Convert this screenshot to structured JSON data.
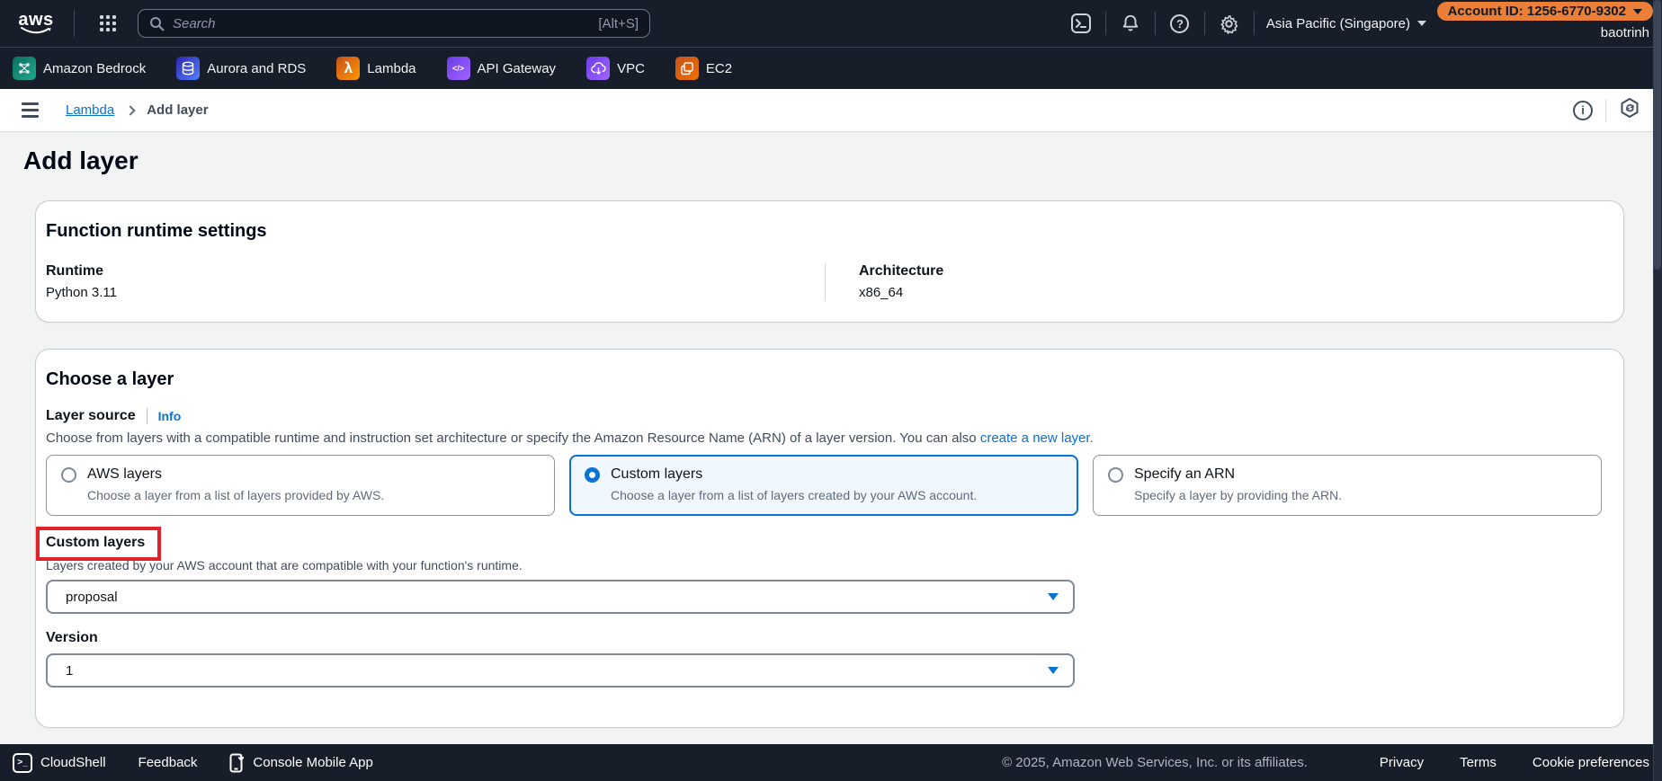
{
  "topbar": {
    "logo": "aws",
    "search_placeholder": "Search",
    "search_shortcut": "[Alt+S]",
    "region_label": "Asia Pacific (Singapore)",
    "account_badge": "Account ID: 1256-6770-9302",
    "username": "baotrinh"
  },
  "favorites": {
    "items": [
      {
        "label": "Amazon Bedrock"
      },
      {
        "label": "Aurora and RDS"
      },
      {
        "label": "Lambda"
      },
      {
        "label": "API Gateway"
      },
      {
        "label": "VPC"
      },
      {
        "label": "EC2"
      }
    ]
  },
  "breadcrumb": {
    "root": "Lambda",
    "current": "Add layer"
  },
  "page_title": "Add layer",
  "runtime_card": {
    "title": "Function runtime settings",
    "runtime_label": "Runtime",
    "runtime_value": "Python 3.11",
    "architecture_label": "Architecture",
    "architecture_value": "x86_64"
  },
  "layer_card": {
    "title": "Choose a layer",
    "source_label": "Layer source",
    "info_link": "Info",
    "description": "Choose from layers with a compatible runtime and instruction set architecture or specify the Amazon Resource Name (ARN) of a layer version. You can also ",
    "description_link": "create a new layer.",
    "options": [
      {
        "title": "AWS layers",
        "desc": "Choose a layer from a list of layers provided by AWS.",
        "selected": false
      },
      {
        "title": "Custom layers",
        "desc": "Choose a layer from a list of layers created by your AWS account.",
        "selected": true
      },
      {
        "title": "Specify an ARN",
        "desc": "Specify a layer by providing the ARN.",
        "selected": false
      }
    ],
    "custom": {
      "label": "Custom layers",
      "desc": "Layers created by your AWS account that are compatible with your function's runtime.",
      "select_value": "proposal"
    },
    "version": {
      "label": "Version",
      "select_value": "1"
    }
  },
  "footer": {
    "cloudshell": "CloudShell",
    "feedback": "Feedback",
    "mobile_app": "Console Mobile App",
    "copyright": "© 2025, Amazon Web Services, Inc. or its affiliates.",
    "privacy": "Privacy",
    "terms": "Terms",
    "cookie_preferences": "Cookie preferences"
  },
  "icons": {
    "lambda_glyph": "λ",
    "api_gateway_glyph": "</>",
    "terminal_glyph": ">_",
    "help_glyph": "?",
    "info_glyph": "i"
  },
  "colors": {
    "accent_blue": "#0972d3",
    "selected_tile_bg": "#f0f7ff",
    "selected_tile_border": "#0972d3",
    "annotation_red": "#e0232a",
    "header_bg": "#171e2a",
    "account_badge_bg": "#ec7f38",
    "page_bg": "#f2f3f3",
    "bedrock_teal": "#1fa98c",
    "aurora_blue": "#527fff",
    "lambda_orange": "#ed7100",
    "api_gateway_purple": "#a166ff",
    "vpc_purple": "#a166ff",
    "ec2_orange": "#ed7100"
  }
}
